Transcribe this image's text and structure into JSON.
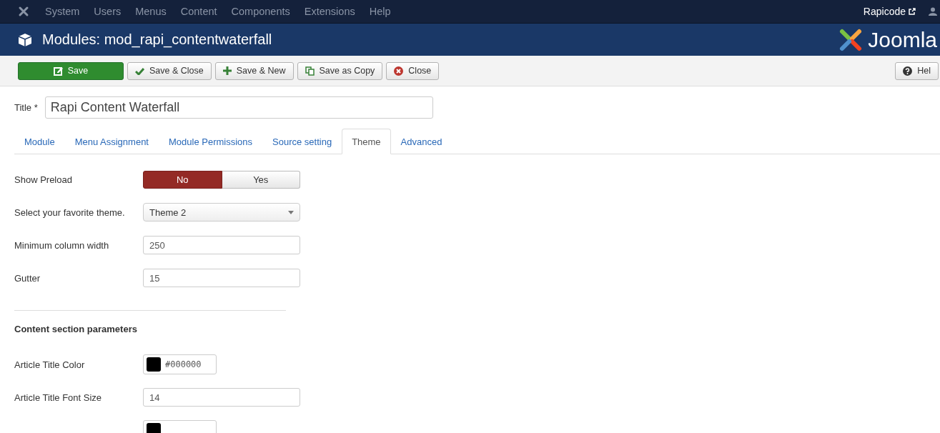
{
  "top_menu": {
    "items": [
      "System",
      "Users",
      "Menus",
      "Content",
      "Components",
      "Extensions",
      "Help"
    ],
    "site_link": "Rapicode"
  },
  "header": {
    "title": "Modules: mod_rapi_contentwaterfall",
    "logo_text": "Joomla"
  },
  "toolbar": {
    "buttons": [
      {
        "label": "Save",
        "kind": "save"
      },
      {
        "label": "Save & Close",
        "kind": "check"
      },
      {
        "label": "Save & New",
        "kind": "plus"
      },
      {
        "label": "Save as Copy",
        "kind": "copy"
      },
      {
        "label": "Close",
        "kind": "close"
      }
    ],
    "help": "Hel"
  },
  "title_field": {
    "label": "Title *",
    "value": "Rapi Content Waterfall"
  },
  "tabs": [
    {
      "label": "Module",
      "selected": false
    },
    {
      "label": "Menu Assignment",
      "selected": false
    },
    {
      "label": "Module Permissions",
      "selected": false
    },
    {
      "label": "Source setting",
      "selected": false
    },
    {
      "label": "Theme",
      "selected": true
    },
    {
      "label": "Advanced",
      "selected": false
    }
  ],
  "fields": [
    {
      "kind": "toggle",
      "label": "Show Preload",
      "options": [
        {
          "label": "No",
          "selected": true
        },
        {
          "label": "Yes",
          "selected": false
        }
      ]
    },
    {
      "kind": "select",
      "label": "Select your favorite theme.",
      "value": "Theme 2"
    },
    {
      "kind": "text",
      "label": "Minimum column width",
      "value": "250"
    },
    {
      "kind": "text",
      "label": "Gutter",
      "value": "15"
    },
    {
      "kind": "divider"
    },
    {
      "kind": "heading",
      "label": "Content section parameters"
    },
    {
      "kind": "color",
      "label": "Article Title Color",
      "value": "#000000",
      "color": "#000000"
    },
    {
      "kind": "text",
      "label": "Article Title Font Size",
      "value": "14"
    },
    {
      "kind": "color",
      "color": "#000000"
    }
  ]
}
